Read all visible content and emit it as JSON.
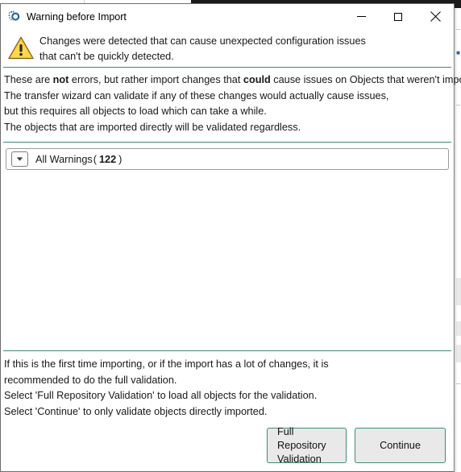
{
  "window": {
    "title": "Warning before Import",
    "icon": "app-dots-circle-icon",
    "controls": {
      "minimize": "Minimize",
      "maximize": "Maximize",
      "close": "Close"
    }
  },
  "header": {
    "icon": "warning-triangle-icon",
    "line1": "Changes were detected that can cause unexpected configuration issues",
    "line2": "that can't be quickly detected."
  },
  "body": {
    "line1_a": "These are ",
    "line1_bold1": "not",
    "line1_b": " errors, but rather import changes that ",
    "line1_bold2": "could",
    "line1_c": " cause issues on Objects that weren't imported.",
    "line2": "The transfer wizard can validate if any of these changes would actually cause issues,",
    "line3": "but this requires all objects to load which can take a while.",
    "line4": "The objects that are imported directly will be validated regardless."
  },
  "warnings_group": {
    "expander_icon": "chevron-down-icon",
    "label": "All Warnings",
    "open_paren": "(",
    "count": "122",
    "close_paren": ")"
  },
  "footer": {
    "line1": "If this is the first time importing, or if the import has a lot of changes, it is",
    "line2": "recommended to do the full validation.",
    "line3": "Select 'Full Repository Validation' to load all objects for the validation.",
    "line4": "Select 'Continue' to only validate objects directly imported.",
    "buttons": {
      "full_repository_line1": "Full Repository",
      "full_repository_line2": "Validation",
      "continue": "Continue"
    }
  },
  "colors": {
    "accent_green": "#3c8f6d",
    "dialog_border": "#6e6e6e",
    "button_face": "#e9e9e9",
    "warning_yellow": "#ffd34d",
    "icon_blue": "#1f5fa8",
    "text": "#181818"
  }
}
